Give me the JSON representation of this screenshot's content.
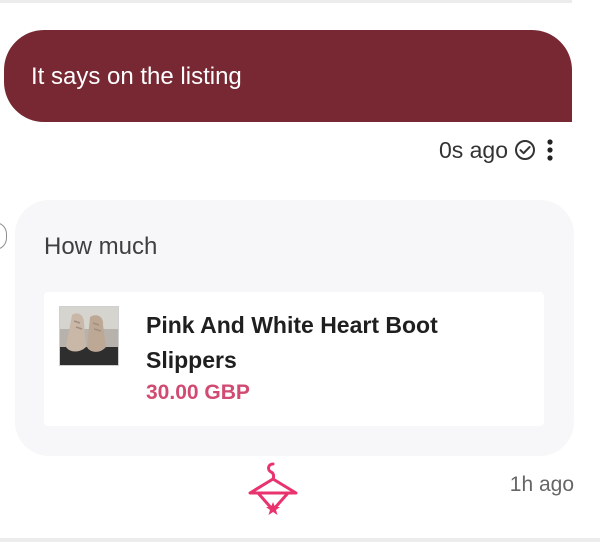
{
  "conversation": {
    "outgoing_message": {
      "text": "It says on the listing",
      "time": "0s ago",
      "status_icon": "read-check-icon",
      "menu_icon": "more-vertical-icon"
    },
    "incoming_message": {
      "text": "How much",
      "time": "1h ago",
      "product": {
        "title": "Pink And White Heart Boot Slippers",
        "price": "30.00 GBP",
        "thumbnail_icon": "slippers-photo"
      }
    },
    "brand_icon": "hanger-logo-icon"
  },
  "colors": {
    "outgoing_bubble": "#772833",
    "incoming_bubble": "#f7f7f9",
    "price": "#d14a72",
    "brand": "#e8336e"
  }
}
